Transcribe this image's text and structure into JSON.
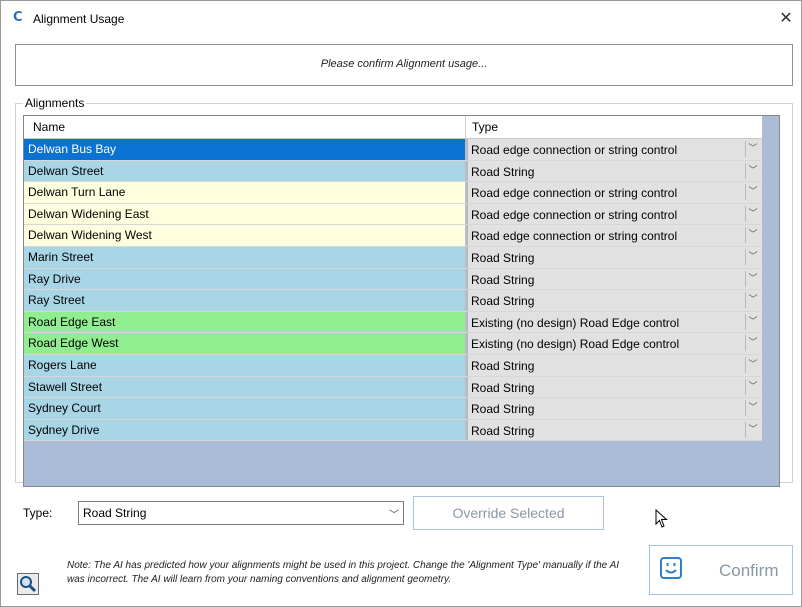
{
  "window": {
    "title": "Alignment Usage",
    "close_glyph": "✕",
    "app_icon_glyph": "C"
  },
  "prompt": "Please confirm Alignment usage...",
  "group_label": "Alignments",
  "grid": {
    "columns": [
      "Name",
      "Type"
    ],
    "rows": [
      {
        "name": "Delwan Bus Bay",
        "type": "Road edge connection or string control",
        "color": "#0a72d2",
        "text_color": "#ffffff"
      },
      {
        "name": "Delwan Street",
        "type": "Road String",
        "color": "#a9d6e6",
        "text_color": "#000000"
      },
      {
        "name": "Delwan Turn Lane",
        "type": "Road edge connection or string control",
        "color": "#ffffe0",
        "text_color": "#000000"
      },
      {
        "name": "Delwan Widening East",
        "type": "Road edge connection or string control",
        "color": "#ffffe0",
        "text_color": "#000000"
      },
      {
        "name": "Delwan Widening West",
        "type": "Road edge connection or string control",
        "color": "#ffffe0",
        "text_color": "#000000"
      },
      {
        "name": "Marin Street",
        "type": "Road String",
        "color": "#a9d6e6",
        "text_color": "#000000"
      },
      {
        "name": "Ray Drive",
        "type": "Road String",
        "color": "#a9d6e6",
        "text_color": "#000000"
      },
      {
        "name": "Ray Street",
        "type": "Road String",
        "color": "#a9d6e6",
        "text_color": "#000000"
      },
      {
        "name": "Road Edge East",
        "type": "Existing (no design) Road Edge control",
        "color": "#90ee90",
        "text_color": "#000000"
      },
      {
        "name": "Road Edge West",
        "type": "Existing (no design) Road Edge control",
        "color": "#90ee90",
        "text_color": "#000000"
      },
      {
        "name": "Rogers Lane",
        "type": "Road String",
        "color": "#a9d6e6",
        "text_color": "#000000"
      },
      {
        "name": "Stawell Street",
        "type": "Road String",
        "color": "#a9d6e6",
        "text_color": "#000000"
      },
      {
        "name": "Sydney Court",
        "type": "Road String",
        "color": "#a9d6e6",
        "text_color": "#000000"
      },
      {
        "name": "Sydney Drive",
        "type": "Road String",
        "color": "#a9d6e6",
        "text_color": "#000000"
      }
    ],
    "dropdown_icon": "chevron-down-icon",
    "background_color": "#abbcd9"
  },
  "type_filter": {
    "label": "Type:",
    "value": "Road String"
  },
  "override_button": "Override Selected",
  "note": "Note: The AI has predicted how your alignments might be used in this project. Change the 'Alignment Type' manually if the AI was incorrect. The AI will learn from your naming conventions and alignment geometry.",
  "confirm_button": "Confirm",
  "colors": {
    "accent": "#0a72d2",
    "button_border": "#a8c3db",
    "button_text": "#8a97a5"
  }
}
